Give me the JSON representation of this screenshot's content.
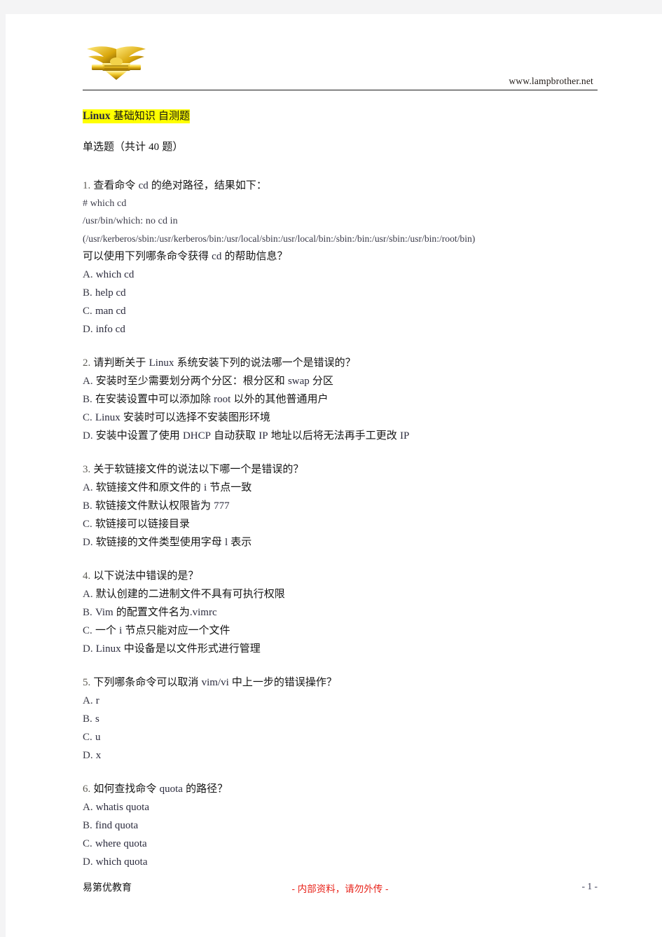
{
  "header": {
    "logo_icon": "winged-crest-logo",
    "site_url": "www.lampbrother.net"
  },
  "title": {
    "latin": "Linux",
    "cjk": "基础知识 自测题",
    "highlight_color": "#ffff00"
  },
  "section": {
    "prefix": "单选题（共计 ",
    "count": "40",
    "suffix": " 题）"
  },
  "questions": [
    {
      "num": "1.",
      "stem_pre": "查看命令 ",
      "stem_code": "cd",
      "stem_post": " 的绝对路径，结果如下：",
      "code_lines": [
        "# which cd",
        "/usr/bin/which: no cd in",
        "(/usr/kerberos/sbin:/usr/kerberos/bin:/usr/local/sbin:/usr/local/bin:/sbin:/bin:/usr/sbin:/usr/bin:/root/bin)"
      ],
      "stem2_pre": "可以使用下列哪条命令获得 ",
      "stem2_code": "cd",
      "stem2_post": " 的帮助信息？",
      "options": [
        {
          "label": "A.",
          "latin": "which cd",
          "cjk": ""
        },
        {
          "label": "B.",
          "latin": "help cd",
          "cjk": ""
        },
        {
          "label": "C.",
          "latin": "man cd",
          "cjk": ""
        },
        {
          "label": "D.",
          "latin": "info cd",
          "cjk": ""
        }
      ]
    },
    {
      "num": "2.",
      "stem_pre": "请判断关于 ",
      "stem_code": "Linux",
      "stem_post": " 系统安装下列的说法哪一个是错误的？",
      "options": [
        {
          "label": "A.",
          "parts": [
            [
              "cjk",
              "安装时至少需要划分两个分区：根分区和 "
            ],
            [
              "lat",
              "swap"
            ],
            [
              "cjk",
              " 分区"
            ]
          ]
        },
        {
          "label": "B.",
          "parts": [
            [
              "cjk",
              "在安装设置中可以添加除 "
            ],
            [
              "lat",
              "root"
            ],
            [
              "cjk",
              " 以外的其他普通用户"
            ]
          ]
        },
        {
          "label": "C.",
          "parts": [
            [
              "lat",
              "Linux"
            ],
            [
              "cjk",
              " 安装时可以选择不安装图形环境"
            ]
          ]
        },
        {
          "label": "D.",
          "parts": [
            [
              "cjk",
              "安装中设置了使用 "
            ],
            [
              "lat",
              "DHCP"
            ],
            [
              "cjk",
              " 自动获取 "
            ],
            [
              "lat",
              "IP"
            ],
            [
              "cjk",
              " 地址以后将无法再手工更改 "
            ],
            [
              "lat",
              "IP"
            ]
          ]
        }
      ]
    },
    {
      "num": "3.",
      "stem_pre": "关于软链接文件的说法以下哪一个是错误的？",
      "options": [
        {
          "label": "A.",
          "parts": [
            [
              "cjk",
              "软链接文件和原文件的 "
            ],
            [
              "lat",
              "i"
            ],
            [
              "cjk",
              " 节点一致"
            ]
          ]
        },
        {
          "label": "B.",
          "parts": [
            [
              "cjk",
              "软链接文件默认权限皆为 "
            ],
            [
              "lat",
              "777"
            ]
          ]
        },
        {
          "label": "C.",
          "parts": [
            [
              "cjk",
              "软链接可以链接目录"
            ]
          ]
        },
        {
          "label": "D.",
          "parts": [
            [
              "cjk",
              "软链接的文件类型使用字母 "
            ],
            [
              "lat",
              "l"
            ],
            [
              "cjk",
              " 表示"
            ]
          ]
        }
      ]
    },
    {
      "num": "4.",
      "stem_pre": "以下说法中错误的是？",
      "options": [
        {
          "label": "A.",
          "parts": [
            [
              "cjk",
              "默认创建的二进制文件不具有可执行权限"
            ]
          ]
        },
        {
          "label": "B.",
          "parts": [
            [
              "lat",
              "Vim"
            ],
            [
              "cjk",
              " 的配置文件名为"
            ],
            [
              "lat",
              ".vimrc"
            ]
          ]
        },
        {
          "label": "C.",
          "parts": [
            [
              "cjk",
              "一个 "
            ],
            [
              "lat",
              "i"
            ],
            [
              "cjk",
              " 节点只能对应一个文件"
            ]
          ]
        },
        {
          "label": "D.",
          "parts": [
            [
              "lat",
              "Linux"
            ],
            [
              "cjk",
              " 中设备是以文件形式进行管理"
            ]
          ]
        }
      ]
    },
    {
      "num": "5.",
      "stem_pre": "下列哪条命令可以取消 ",
      "stem_code": "vim/vi",
      "stem_post": " 中上一步的错误操作？",
      "options": [
        {
          "label": "A.",
          "latin": "r",
          "cjk": ""
        },
        {
          "label": "B.",
          "latin": "s",
          "cjk": ""
        },
        {
          "label": "C.",
          "latin": "u",
          "cjk": ""
        },
        {
          "label": "D.",
          "latin": "x",
          "cjk": ""
        }
      ]
    },
    {
      "num": "6.",
      "stem_pre": "如何查找命令 ",
      "stem_code": "quota",
      "stem_post": " 的路径？",
      "options": [
        {
          "label": "A.",
          "latin": "whatis quota",
          "cjk": ""
        },
        {
          "label": "B.",
          "latin": "find quota",
          "cjk": ""
        },
        {
          "label": "C.",
          "latin": "where quota",
          "cjk": ""
        },
        {
          "label": "D.",
          "latin": "which quota",
          "cjk": ""
        }
      ]
    }
  ],
  "footer": {
    "left": "易第优教育",
    "center": "- 内部资料，请勿外传 -",
    "page": "- 1 -",
    "center_color": "#e8231a"
  }
}
